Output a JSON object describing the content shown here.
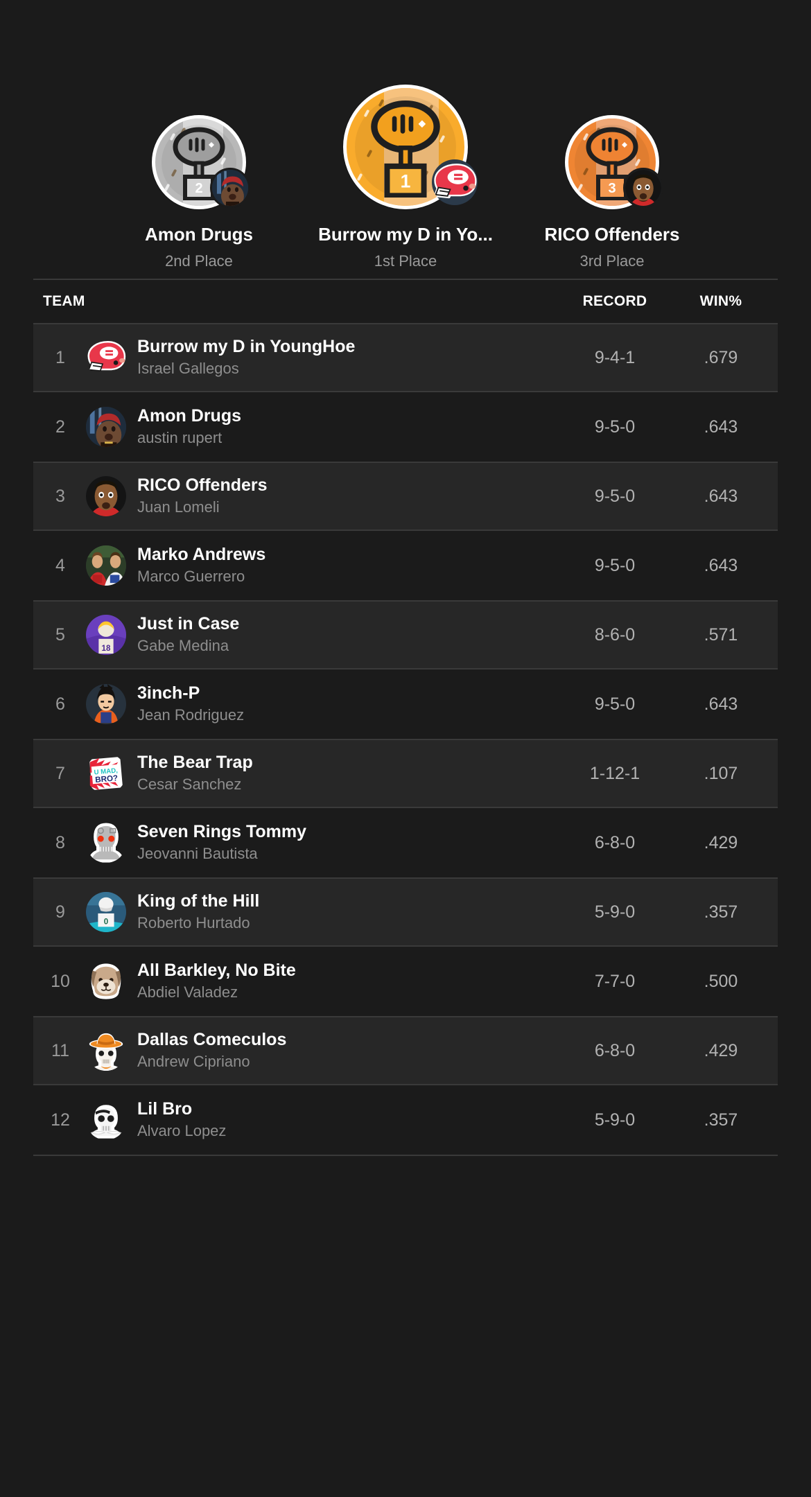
{
  "podium": {
    "slots": [
      {
        "team_name": "Amon Drugs",
        "place_label": "2nd Place",
        "place_chip": "2",
        "place_suffix": "ND",
        "medal_color": "#b8b8b8",
        "avatar_icon": "rapper-photo-avatar"
      },
      {
        "team_name": "Burrow my D in Yo...",
        "place_label": "1st Place",
        "place_chip": "1",
        "place_suffix": "ST",
        "medal_color": "#f9ab2c",
        "avatar_icon": "red-football-helmet-icon"
      },
      {
        "team_name": "RICO Offenders",
        "place_label": "3rd Place",
        "place_chip": "3",
        "place_suffix": "RD",
        "medal_color": "#ef8533",
        "avatar_icon": "cartoon-man-face-avatar"
      }
    ]
  },
  "table": {
    "columns": {
      "team": "TEAM",
      "record": "RECORD",
      "winpct": "WIN%"
    },
    "rows": [
      {
        "rank": "1",
        "team": "Burrow my D in YoungHoe",
        "owner": "Israel Gallegos",
        "record": "9-4-1",
        "winpct": ".679",
        "avatar_icon": "red-football-helmet-icon"
      },
      {
        "rank": "2",
        "team": "Amon Drugs",
        "owner": "austin rupert",
        "record": "9-5-0",
        "winpct": ".643",
        "avatar_icon": "rapper-photo-avatar"
      },
      {
        "rank": "3",
        "team": "RICO Offenders",
        "owner": "Juan Lomeli",
        "record": "9-5-0",
        "winpct": ".643",
        "avatar_icon": "cartoon-man-face-avatar"
      },
      {
        "rank": "4",
        "team": "Marko Andrews",
        "owner": "Marco Guerrero",
        "record": "9-5-0",
        "winpct": ".643",
        "avatar_icon": "two-players-photo-avatar"
      },
      {
        "rank": "5",
        "team": "Just in Case",
        "owner": "Gabe Medina",
        "record": "8-6-0",
        "winpct": ".571",
        "avatar_icon": "vikings-player-photo-avatar"
      },
      {
        "rank": "6",
        "team": "3inch-P",
        "owner": "Jean Rodriguez",
        "record": "9-5-0",
        "winpct": ".643",
        "avatar_icon": "anime-character-avatar"
      },
      {
        "rank": "7",
        "team": "The Bear Trap",
        "owner": "Cesar Sanchez",
        "record": "1-12-1",
        "winpct": ".107",
        "avatar_icon": "u-mad-bro-sticker-icon"
      },
      {
        "rank": "8",
        "team": "Seven Rings Tommy",
        "owner": "Jeovanni Bautista",
        "record": "6-8-0",
        "winpct": ".429",
        "avatar_icon": "terminator-skull-icon"
      },
      {
        "rank": "9",
        "team": "King of the Hill",
        "owner": "Roberto Hurtado",
        "record": "5-9-0",
        "winpct": ".357",
        "avatar_icon": "dolphins-player-photo-avatar"
      },
      {
        "rank": "10",
        "team": "All Barkley, No Bite",
        "owner": "Abdiel Valadez",
        "record": "7-7-0",
        "winpct": ".500",
        "avatar_icon": "dog-face-icon"
      },
      {
        "rank": "11",
        "team": "Dallas Comeculos",
        "owner": "Andrew Cipriano",
        "record": "6-8-0",
        "winpct": ".429",
        "avatar_icon": "cowboy-skull-icon"
      },
      {
        "rank": "12",
        "team": "Lil Bro",
        "owner": "Alvaro Lopez",
        "record": "5-9-0",
        "winpct": ".357",
        "avatar_icon": "pirate-skull-icon"
      }
    ]
  },
  "colors": {
    "background": "#1b1b1b",
    "row_alt": "#272727",
    "divider": "#3a3a3a",
    "primary_text": "#ffffff",
    "secondary_text": "#9a9a9a",
    "gold": "#f9ab2c",
    "silver": "#b8b8b8",
    "bronze": "#ef8533"
  }
}
